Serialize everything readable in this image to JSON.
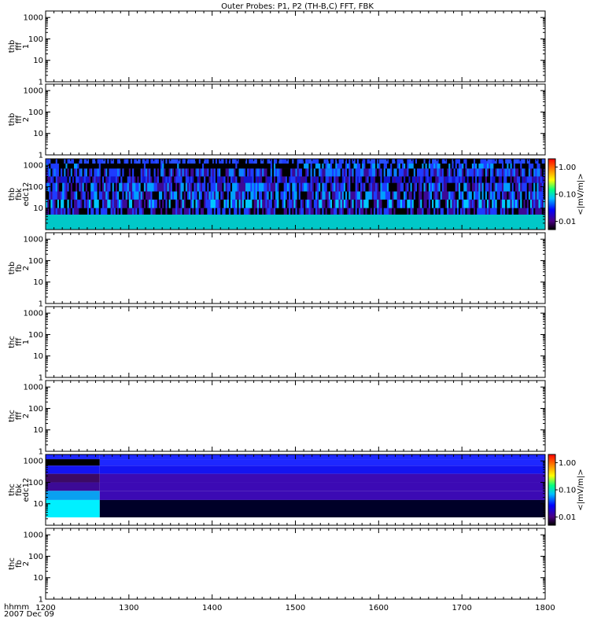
{
  "title": "Outer Probes: P1, P2 (TH-B,C) FFT, FBK",
  "time_axis": {
    "label_line1": "hhmm",
    "label_line2": "2007 Dec 09",
    "ticks": [
      "1200",
      "1300",
      "1400",
      "1500",
      "1600",
      "1700",
      "1800"
    ],
    "range": [
      1200,
      1800
    ]
  },
  "panels": [
    {
      "label": [
        "thb",
        "fff",
        "1"
      ],
      "yticks": [
        "1",
        "10",
        "100",
        "1000"
      ],
      "kind": "empty"
    },
    {
      "label": [
        "thb",
        "fff",
        "2"
      ],
      "yticks": [
        "1",
        "10",
        "100",
        "1000"
      ],
      "kind": "empty"
    },
    {
      "label": [
        "thb",
        "fbk",
        "edc12"
      ],
      "yticks": [
        "10",
        "100",
        "1000"
      ],
      "kind": "spectrogram_noisy",
      "colorbar": {
        "ticks": [
          "1.00",
          "0.10",
          "0.01"
        ],
        "unit": "<|mV/m|>"
      }
    },
    {
      "label": [
        "thb",
        "fb",
        "2"
      ],
      "yticks": [
        "1",
        "10",
        "100",
        "1000"
      ],
      "kind": "empty"
    },
    {
      "label": [
        "thc",
        "fff",
        "1"
      ],
      "yticks": [
        "1",
        "10",
        "100",
        "1000"
      ],
      "kind": "empty"
    },
    {
      "label": [
        "thc",
        "fff",
        "2"
      ],
      "yticks": [
        "1",
        "10",
        "100",
        "1000"
      ],
      "kind": "empty"
    },
    {
      "label": [
        "thc",
        "fbk",
        "edc12"
      ],
      "yticks": [
        "10",
        "100",
        "1000"
      ],
      "kind": "spectrogram_bands",
      "colorbar": {
        "ticks": [
          "1.00",
          "0.10",
          "0.01"
        ],
        "unit": "<|mV/m|>"
      }
    },
    {
      "label": [
        "thc",
        "fb",
        "2"
      ],
      "yticks": [
        "1",
        "10",
        "100",
        "1000"
      ],
      "kind": "empty"
    }
  ],
  "chart_data": {
    "type": "heatmap",
    "title": "Outer Probes: P1, P2 (TH-B,C) FFT, FBK",
    "x_range": [
      1200,
      1800
    ],
    "y_scale": "log",
    "y_range": [
      1,
      2000
    ],
    "colorbar_scale": "log",
    "colorbar_range": [
      0.005,
      2.0
    ],
    "thc_edc12_blocks": [
      {
        "x_start": 1200,
        "x_end": 1265,
        "bands": [
          "#1e28ff",
          "#000000",
          "#1414f0",
          "#3c0a64",
          "#3c0a96",
          "#0aa0f0",
          "#00f0ff"
        ]
      },
      {
        "x_start": 1265,
        "x_end": 1800,
        "bands": [
          "#1e28ff",
          "#1e28ff",
          "#1414f0",
          "#3c0ab4",
          "#3c0ab4",
          "#3c0ab4",
          "#000028"
        ]
      }
    ]
  }
}
